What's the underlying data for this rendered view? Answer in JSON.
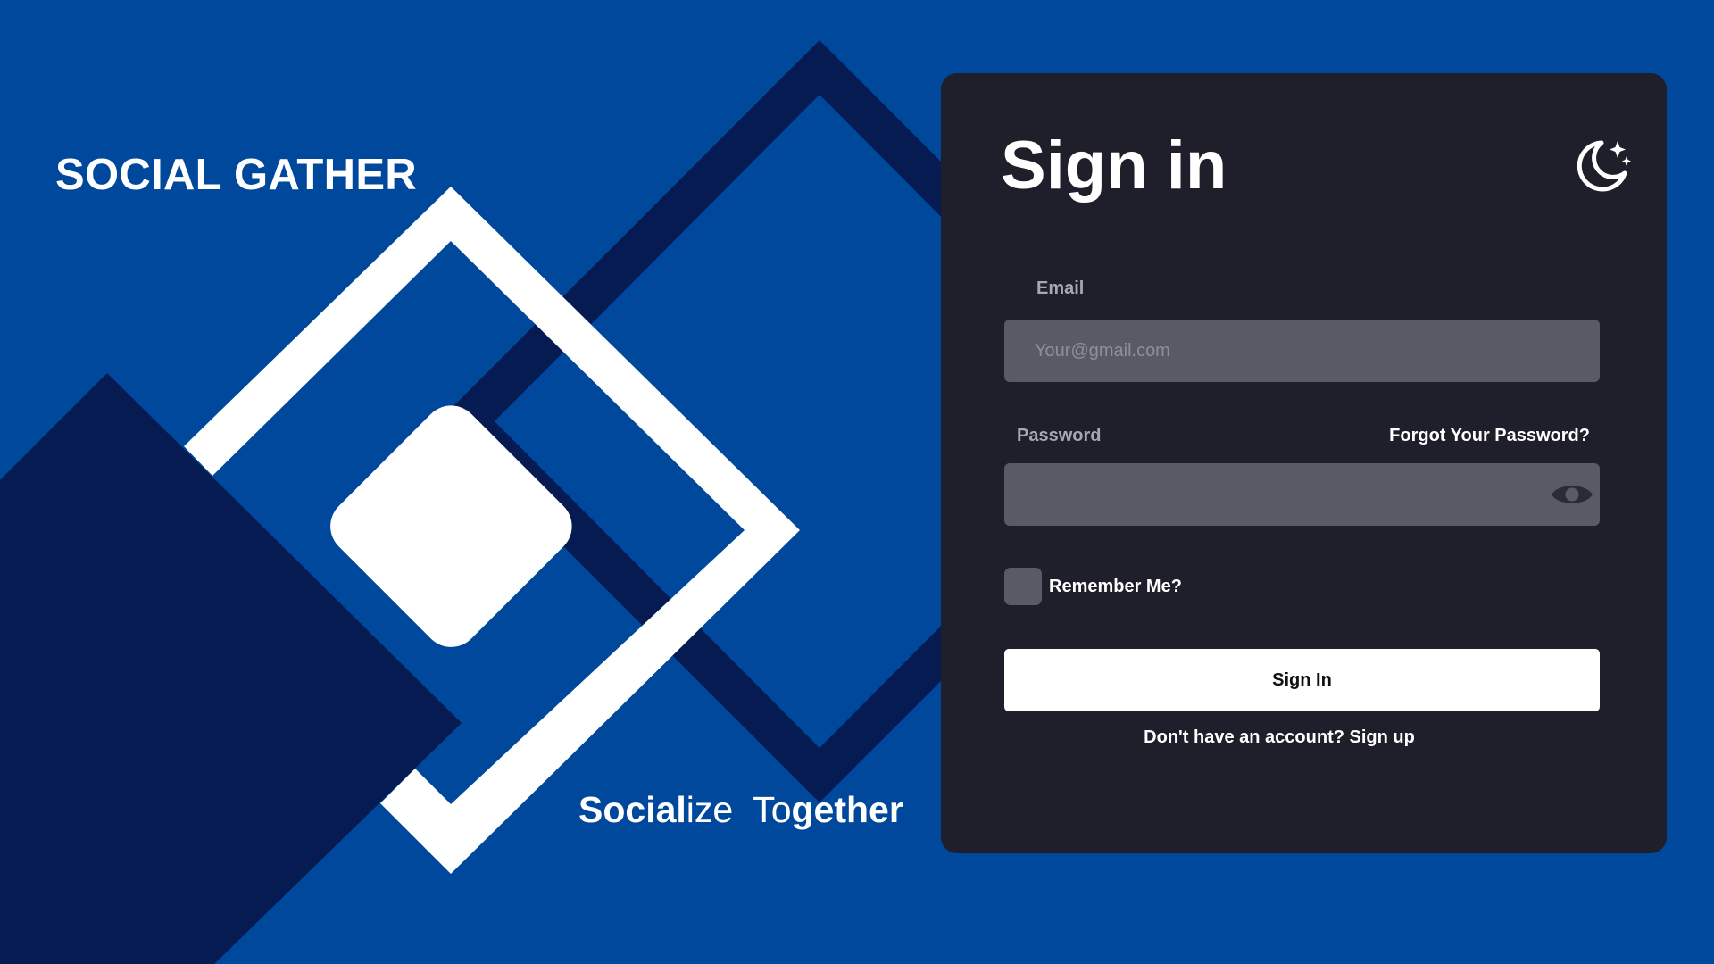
{
  "brand": {
    "name": "SOCIAL GATHER"
  },
  "tagline": {
    "part1_bold": "Socia",
    "part1_light_a": "l",
    "part1_bold_b": "",
    "word1_b": "Social",
    "word1_l": "ize",
    "word2_l": "To",
    "word2_b": "gether"
  },
  "colors": {
    "background": "#00489b",
    "dark_shape": "#061b52",
    "card": "#1f1f2b",
    "input": "#5a5a67",
    "button": "#ffffff"
  },
  "signin": {
    "title": "Sign in",
    "theme_icon": "moon-stars-icon",
    "email": {
      "label": "Email",
      "placeholder": "Your@gmail.com",
      "value": ""
    },
    "password": {
      "label": "Password",
      "placeholder": "",
      "value": "",
      "visibility_icon": "eye-icon"
    },
    "forgot_label": "Forgot Your Password?",
    "remember_label": "Remember Me?",
    "remember_checked": false,
    "submit_label": "Sign In",
    "signup_prompt": "Don't have an account?",
    "signup_link": "Sign up"
  }
}
